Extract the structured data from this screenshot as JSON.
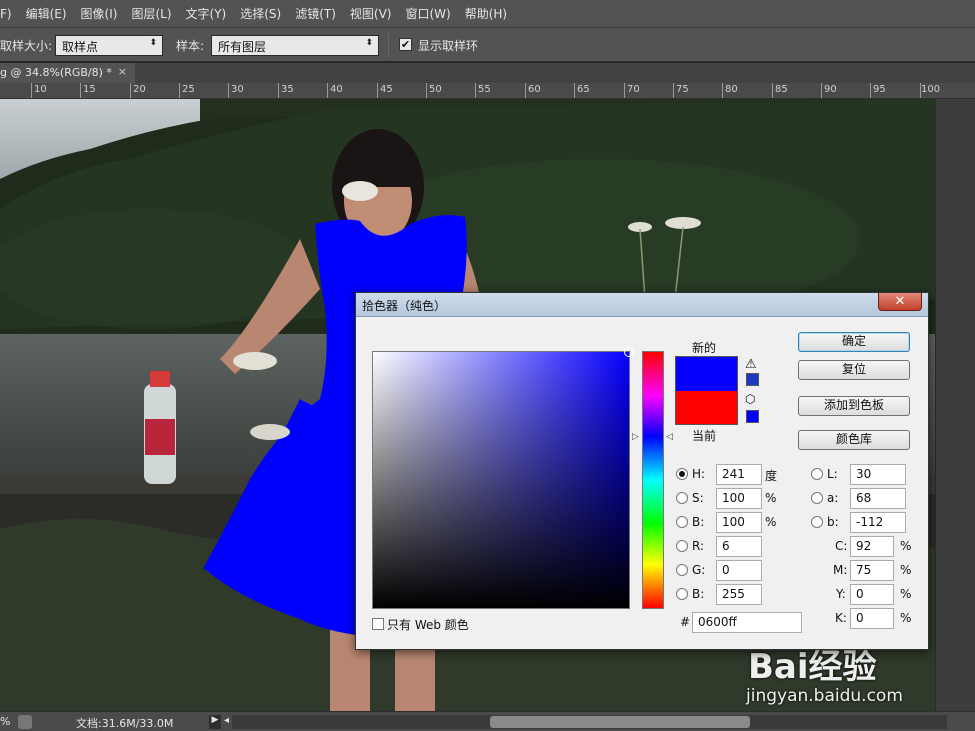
{
  "menu": [
    "F)",
    "编辑(E)",
    "图像(I)",
    "图层(L)",
    "文字(Y)",
    "选择(S)",
    "滤镜(T)",
    "视图(V)",
    "窗口(W)",
    "帮助(H)"
  ],
  "options": {
    "sample_size_label": "取样大小:",
    "sample_size_value": "取样点",
    "sample_label": "样本:",
    "sample_value": "所有图层",
    "show_ring_label": "显示取样环",
    "show_ring_checked": "✔"
  },
  "document_tab": {
    "title": "g @ 34.8%(RGB/8) *",
    "close": "×"
  },
  "ruler": [
    "10",
    "15",
    "20",
    "25",
    "30",
    "35",
    "40",
    "45",
    "50",
    "55",
    "60",
    "65",
    "70",
    "75",
    "80",
    "85",
    "90",
    "95",
    "100"
  ],
  "status": {
    "zoom": "%",
    "doc_size": "文档:31.6M/33.0M",
    "play": "▶",
    "left": "◂"
  },
  "watermark": {
    "brand": "Bai经验",
    "url": "jingyan.baidu.com"
  },
  "dialog": {
    "title": "拾色器（纯色）",
    "close": "✕",
    "new_label": "新的",
    "current_label": "当前",
    "new_color": "#0600ff",
    "current_color": "#ff0000",
    "gamut_warning_icon": "warning-icon",
    "web_safe_icon": "cube-icon",
    "web_only_label": "只有 Web 颜色",
    "buttons": {
      "ok": "确定",
      "reset": "复位",
      "add_swatch": "添加到色板",
      "libraries": "颜色库"
    },
    "hsb": {
      "h_label": "H:",
      "h_value": "241",
      "h_unit": "度",
      "s_label": "S:",
      "s_value": "100",
      "s_unit": "%",
      "b_label": "B:",
      "b_value": "100",
      "b_unit": "%"
    },
    "rgb": {
      "r_label": "R:",
      "r_value": "6",
      "g_label": "G:",
      "g_value": "0",
      "b_label": "B:",
      "b_value": "255"
    },
    "lab": {
      "l_label": "L:",
      "l_value": "30",
      "a_label": "a:",
      "a_value": "68",
      "b_label": "b:",
      "b_value": "-112"
    },
    "cmyk": {
      "c_label": "C:",
      "c_value": "92",
      "m_label": "M:",
      "m_value": "75",
      "y_label": "Y:",
      "y_value": "0",
      "k_label": "K:",
      "k_value": "0",
      "unit": "%"
    },
    "hex_label": "#",
    "hex_value": "0600ff"
  }
}
